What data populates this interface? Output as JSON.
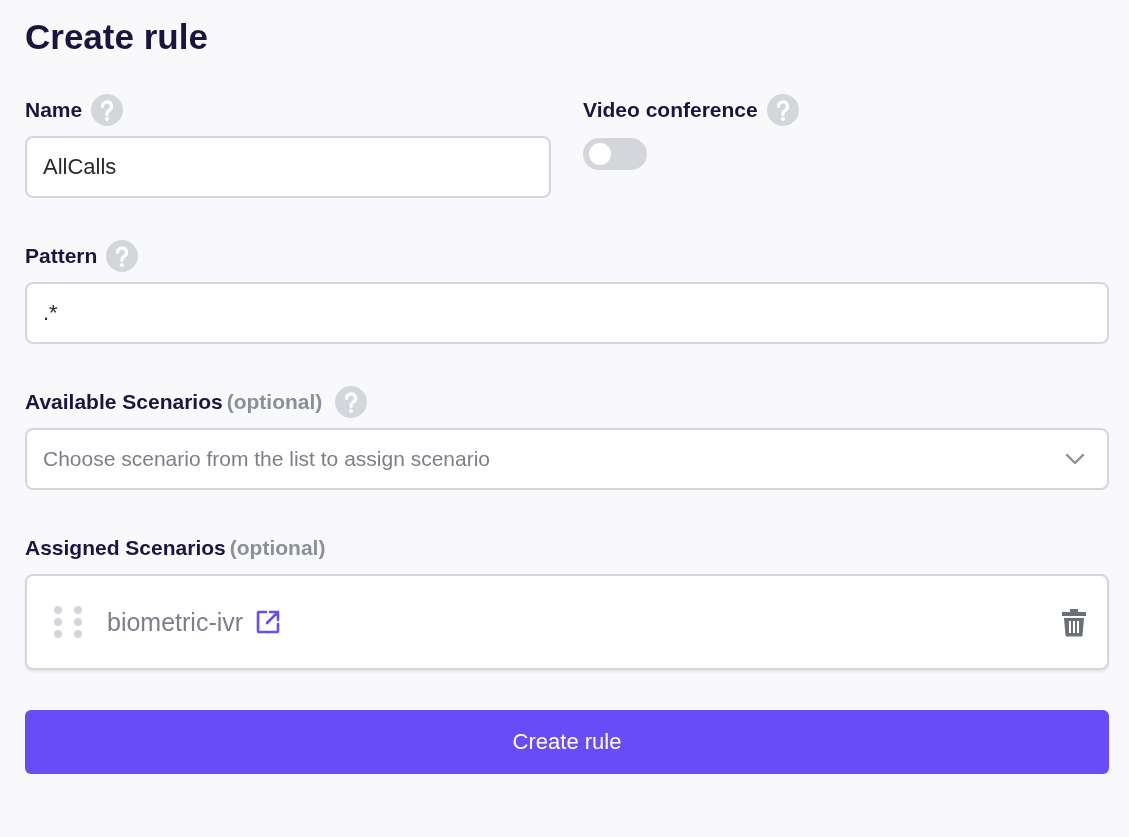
{
  "title": "Create rule",
  "name_field": {
    "label": "Name",
    "value": "AllCalls"
  },
  "video_conference": {
    "label": "Video conference",
    "on": false
  },
  "pattern_field": {
    "label": "Pattern",
    "value": ".*"
  },
  "available_scenarios": {
    "label": "Available Scenarios",
    "hint": "(optional)",
    "placeholder": "Choose scenario from the list to assign scenario"
  },
  "assigned_scenarios": {
    "label": "Assigned Scenarios",
    "hint": "(optional)",
    "items": [
      {
        "name": "biometric-ivr"
      }
    ]
  },
  "submit_button": "Create rule"
}
